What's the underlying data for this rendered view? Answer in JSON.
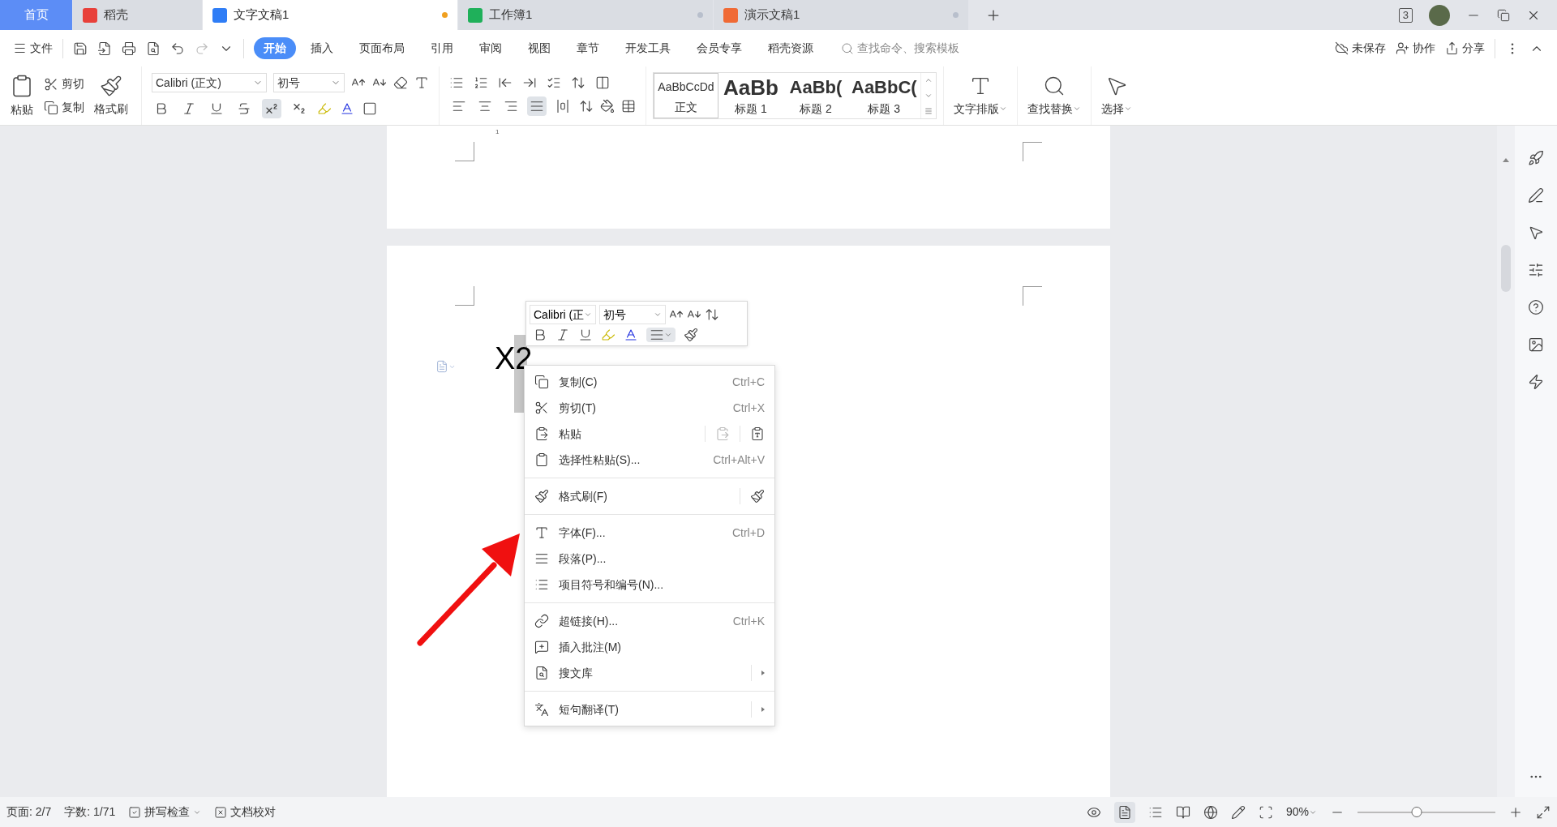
{
  "tabs": [
    {
      "kind": "home",
      "label": "首页",
      "selected": false
    },
    {
      "kind": "docer",
      "label": "稻壳",
      "selected": false
    },
    {
      "kind": "writer",
      "label": "文字文稿1",
      "selected": true,
      "dot": {
        "color": "#f0a020"
      }
    },
    {
      "kind": "sheet",
      "label": "工作簿1",
      "selected": false,
      "dot": {
        "color": "#b8bfcc"
      }
    },
    {
      "kind": "slides",
      "label": "演示文稿1",
      "selected": false,
      "dot": {
        "color": "#b8bfcc"
      }
    }
  ],
  "window_badge": "3",
  "file_menu": "文件",
  "ribbon_tabs": [
    {
      "label": "开始",
      "selected": true
    },
    {
      "label": "插入",
      "selected": false
    },
    {
      "label": "页面布局",
      "selected": false
    },
    {
      "label": "引用",
      "selected": false
    },
    {
      "label": "审阅",
      "selected": false
    },
    {
      "label": "视图",
      "selected": false
    },
    {
      "label": "章节",
      "selected": false
    },
    {
      "label": "开发工具",
      "selected": false
    },
    {
      "label": "会员专享",
      "selected": false
    },
    {
      "label": "稻壳资源",
      "selected": false
    }
  ],
  "command_search": {
    "placeholder": "查找命令、搜索模板"
  },
  "actions": [
    "未保存",
    "协作",
    "分享"
  ],
  "clipboard": {
    "paste": "粘贴",
    "cut": "剪切",
    "copy": "复制",
    "format_painter": "格式刷"
  },
  "font": {
    "name": "Calibri (正文)",
    "size": "初号"
  },
  "format_buttons": [
    {
      "kind": "bold",
      "selected": false
    },
    {
      "kind": "italic",
      "selected": false
    },
    {
      "kind": "underline",
      "selected": false
    },
    {
      "kind": "strike",
      "selected": false
    },
    {
      "kind": "superscript",
      "selected": true
    },
    {
      "kind": "subscript",
      "selected": false
    }
  ],
  "align_buttons": [
    {
      "kind": "left",
      "selected": false
    },
    {
      "kind": "center",
      "selected": false
    },
    {
      "kind": "right",
      "selected": false
    },
    {
      "kind": "justify",
      "selected": true
    },
    {
      "kind": "distributed",
      "selected": false
    }
  ],
  "styles": [
    {
      "sample": "AaBbCcDd",
      "label": "正文",
      "selected": true
    },
    {
      "sample": "AaBb",
      "label": "标题 1",
      "selected": false
    },
    {
      "sample": "AaBb(",
      "label": "标题 2",
      "selected": false
    },
    {
      "sample": "AaBbC(",
      "label": "标题 3",
      "selected": false
    }
  ],
  "big_buttons": [
    "文字排版",
    "查找替换",
    "选择"
  ],
  "page_number": "1",
  "document_text": "X2",
  "mini_toolbar": {
    "font": "Calibri (正",
    "size": "初号"
  },
  "context_menu": [
    {
      "kind": "item",
      "label": "复制(C)",
      "shortcut": "Ctrl+C"
    },
    {
      "kind": "item",
      "label": "剪切(T)",
      "shortcut": "Ctrl+X"
    },
    {
      "kind": "paste",
      "label": "粘贴"
    },
    {
      "kind": "item",
      "label": "选择性粘贴(S)...",
      "shortcut": "Ctrl+Alt+V"
    },
    {
      "kind": "separator"
    },
    {
      "kind": "brush",
      "label": "格式刷(F)"
    },
    {
      "kind": "separator"
    },
    {
      "kind": "item",
      "label": "字体(F)...",
      "shortcut": "Ctrl+D"
    },
    {
      "kind": "item",
      "label": "段落(P)..."
    },
    {
      "kind": "item",
      "label": "项目符号和编号(N)..."
    },
    {
      "kind": "separator"
    },
    {
      "kind": "item",
      "label": "超链接(H)...",
      "shortcut": "Ctrl+K"
    },
    {
      "kind": "item",
      "label": "插入批注(M)"
    },
    {
      "kind": "submenu",
      "label": "搜文库"
    },
    {
      "kind": "separator"
    },
    {
      "kind": "submenu",
      "label": "短句翻译(T)"
    }
  ],
  "status_bar": {
    "page": "页面: 2/7",
    "words": "字数: 1/71",
    "spell_check": "拼写检查",
    "proofread": "文档校对",
    "zoom": "90%",
    "zoom_slider": {
      "level": 0.43
    }
  }
}
